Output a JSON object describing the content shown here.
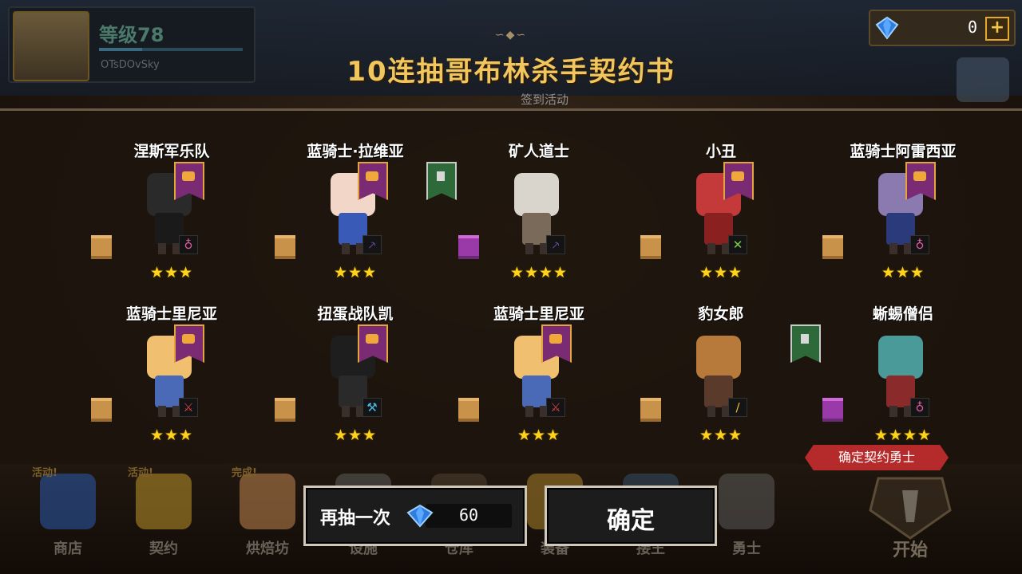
{
  "player": {
    "level": "等级78",
    "name": "OTsDOvSky"
  },
  "currency": {
    "gems": "0",
    "plus": "+"
  },
  "background": {
    "checkin_label": "签到活动"
  },
  "title": "10连抽哥布林杀手契约书",
  "title_ornament": "∽◆∽",
  "heroes": [
    {
      "name": "涅斯军乐队",
      "stars": "★★★",
      "banner": "purple",
      "scroll": "tan",
      "role_icon": "pink-circle-icon",
      "role_glyph": "♁",
      "role_color": "#e05aa0"
    },
    {
      "name": "蓝骑士·拉维亚",
      "stars": "★★★",
      "banner": "purple",
      "scroll": "tan",
      "role_icon": "purple-staff-icon",
      "role_glyph": "⸕",
      "role_color": "#9a6ae0"
    },
    {
      "name": "矿人道士",
      "stars": "★★★★",
      "banner": "green",
      "scroll": "purple",
      "role_icon": "purple-staff-icon",
      "role_glyph": "⸕",
      "role_color": "#9a6ae0"
    },
    {
      "name": "小丑",
      "stars": "★★★",
      "banner": "purple",
      "scroll": "tan",
      "role_icon": "green-cross-icon",
      "role_glyph": "✕",
      "role_color": "#7ad04a"
    },
    {
      "name": "蓝骑士阿雷西亚",
      "stars": "★★★",
      "banner": "purple",
      "scroll": "tan",
      "role_icon": "pink-circle-icon",
      "role_glyph": "♁",
      "role_color": "#e05aa0"
    },
    {
      "name": "蓝骑士里尼亚",
      "stars": "★★★",
      "banner": "purple",
      "scroll": "tan",
      "role_icon": "red-sword-icon",
      "role_glyph": "⚔",
      "role_color": "#e04040"
    },
    {
      "name": "扭蛋战队凯",
      "stars": "★★★",
      "banner": "purple",
      "scroll": "tan",
      "role_icon": "blue-hammer-icon",
      "role_glyph": "⚒",
      "role_color": "#4ab8e8"
    },
    {
      "name": "蓝骑士里尼亚",
      "stars": "★★★",
      "banner": "purple",
      "scroll": "tan",
      "role_icon": "red-sword-icon",
      "role_glyph": "⚔",
      "role_color": "#e04040"
    },
    {
      "name": "豹女郎",
      "stars": "★★★",
      "banner": "none",
      "scroll": "tan",
      "role_icon": "gold-dagger-icon",
      "role_glyph": "∕",
      "role_color": "#f0c030"
    },
    {
      "name": "蜥蜴僧侣",
      "stars": "★★★★",
      "banner": "green",
      "scroll": "purple",
      "role_icon": "pink-circle-icon",
      "role_glyph": "♁",
      "role_color": "#e05aa0"
    }
  ],
  "confirm_tag": "确定契约勇士",
  "buttons": {
    "redraw": "再抽一次",
    "redraw_cost": "60",
    "confirm": "确定"
  },
  "nav": [
    {
      "label": "商店",
      "badge": "活动!"
    },
    {
      "label": "契约",
      "badge": "活动!"
    },
    {
      "label": "烘焙坊",
      "badge": "完成!"
    },
    {
      "label": "设施",
      "badge": ""
    },
    {
      "label": "仓库",
      "badge": ""
    },
    {
      "label": "装备",
      "badge": ""
    },
    {
      "label": "接王",
      "badge": ""
    },
    {
      "label": "勇士",
      "badge": ""
    }
  ],
  "start_label": "开始",
  "colors": {
    "title_gold": "#f1c65c",
    "star_yellow": "#ffd21c",
    "confirm_red": "#b52a2a"
  }
}
